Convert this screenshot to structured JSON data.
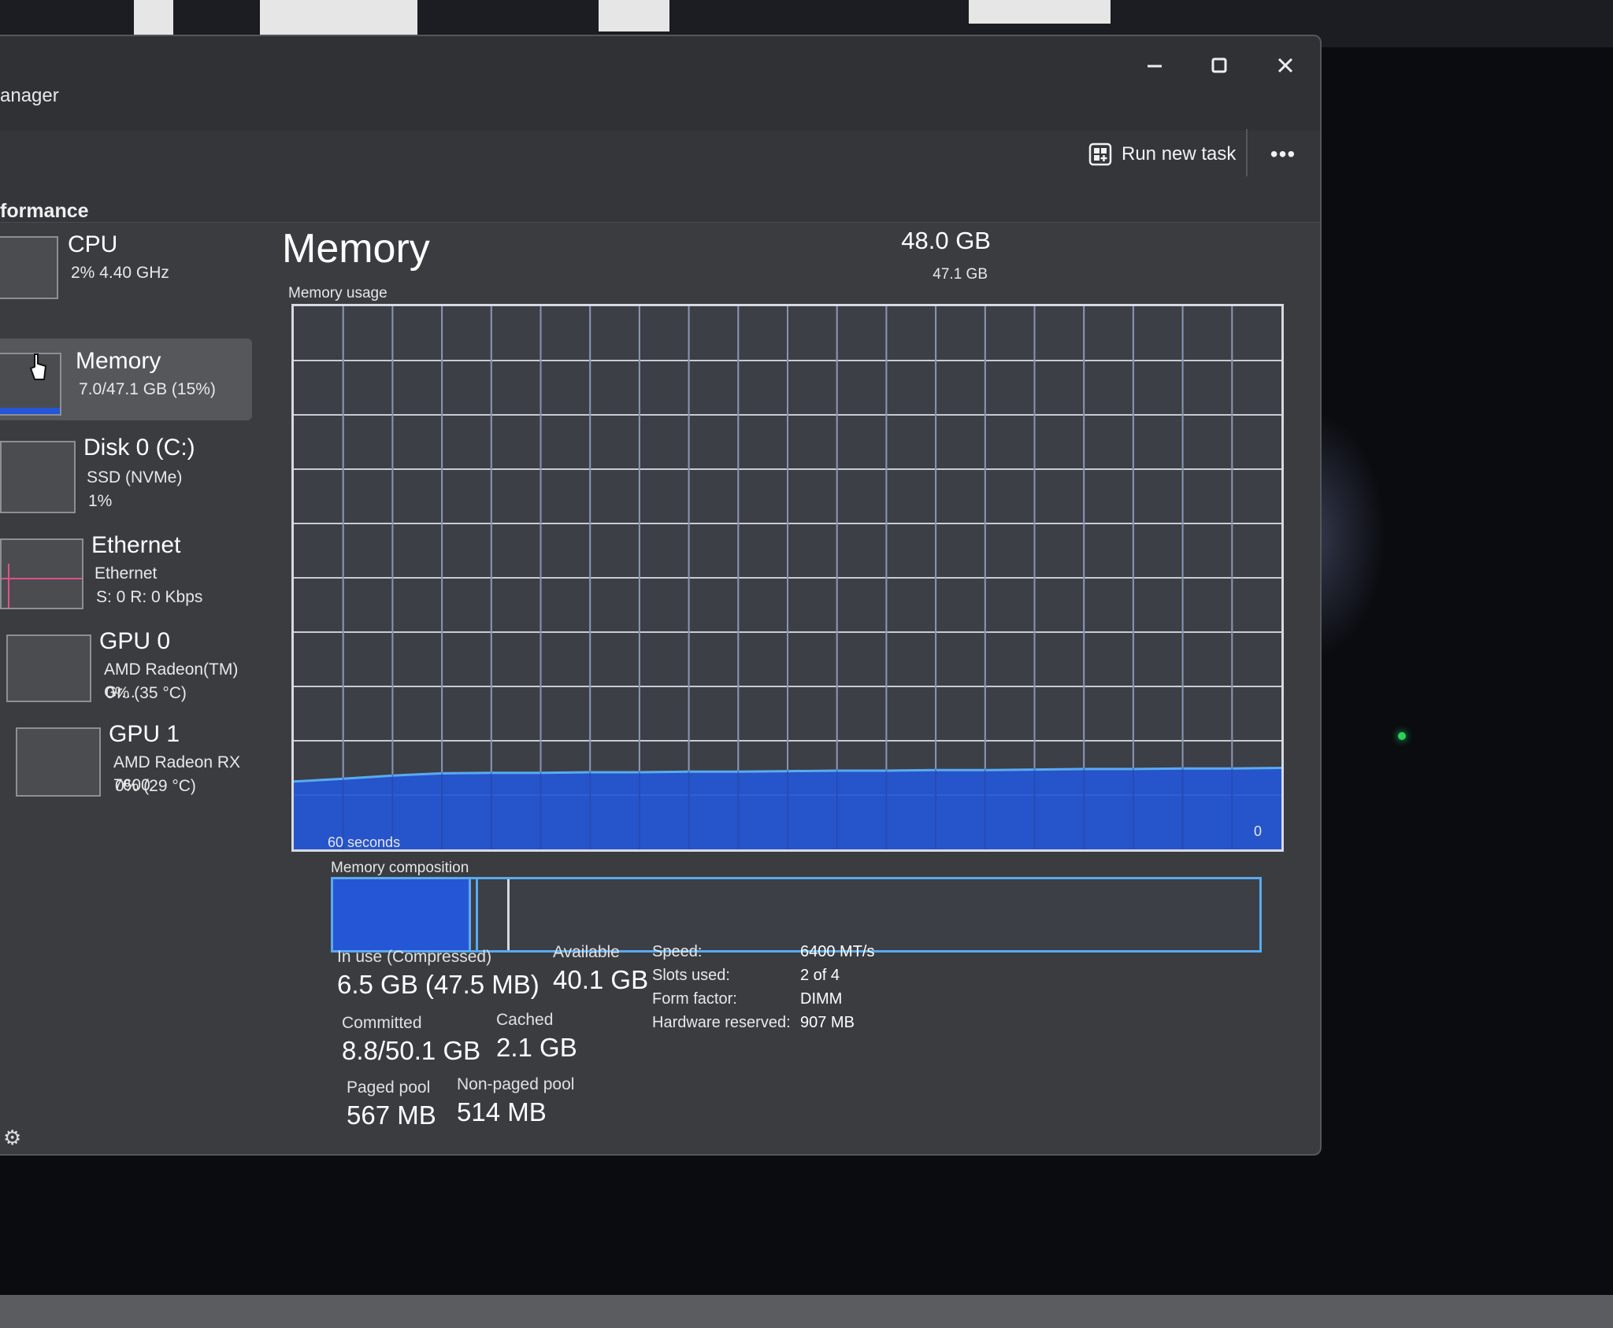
{
  "window": {
    "title": "anager",
    "controls": {
      "minimize": "minimize",
      "maximize": "maximize",
      "close": "close"
    }
  },
  "toolbar": {
    "page_heading": "formance",
    "run_new_task_label": "Run new task",
    "more_label": "•••"
  },
  "sidebar": {
    "items": [
      {
        "name": "CPU",
        "lines": [
          "2% 4.40 GHz"
        ]
      },
      {
        "name": "Memory",
        "lines": [
          "7.0/47.1 GB (15%)"
        ],
        "selected": true
      },
      {
        "name": "Disk 0 (C:)",
        "lines": [
          "SSD (NVMe)",
          "1%"
        ]
      },
      {
        "name": "Ethernet",
        "lines": [
          "Ethernet",
          "S: 0 R: 0 Kbps"
        ]
      },
      {
        "name": "GPU 0",
        "lines": [
          "AMD Radeon(TM) Gr...",
          "0% (35 °C)"
        ]
      },
      {
        "name": "GPU 1",
        "lines": [
          "AMD Radeon RX 7600",
          "0% (29 °C)"
        ]
      }
    ]
  },
  "main": {
    "title": "Memory",
    "total": "48.0 GB",
    "graph_max": "47.1 GB",
    "usage_caption": "Memory usage",
    "graph_time_label": "60 seconds",
    "graph_zero_label": "0",
    "composition_caption": "Memory composition",
    "usage_percent_history": [
      12.5,
      13.0,
      13.6,
      14.0,
      14.1,
      14.1,
      14.2,
      14.2,
      14.3,
      14.3,
      14.4,
      14.5,
      14.5,
      14.6,
      14.6,
      14.7,
      14.8,
      14.8,
      14.9,
      14.9,
      15.0
    ],
    "composition": {
      "in_use_fraction": 0.146,
      "modified_fraction": 0.01,
      "standby_fraction": 0.034
    },
    "stats": {
      "in_use": {
        "label": "In use (Compressed)",
        "value": "6.5 GB (47.5 MB)"
      },
      "available": {
        "label": "Available",
        "value": "40.1 GB"
      },
      "committed": {
        "label": "Committed",
        "value": "8.8/50.1 GB"
      },
      "cached": {
        "label": "Cached",
        "value": "2.1 GB"
      },
      "paged_pool": {
        "label": "Paged pool",
        "value": "567 MB"
      },
      "non_paged_pool": {
        "label": "Non-paged pool",
        "value": "514 MB"
      }
    },
    "details": [
      {
        "key": "Speed:",
        "value": "6400 MT/s"
      },
      {
        "key": "Slots used:",
        "value": "2 of 4"
      },
      {
        "key": "Form factor:",
        "value": "DIMM"
      },
      {
        "key": "Hardware reserved:",
        "value": "907 MB"
      }
    ]
  },
  "colors": {
    "accent": "#2556d6",
    "accent_border": "#5aaaf0",
    "grid": "#c8ccd4"
  },
  "icons": {
    "run_task": "run-task-icon",
    "settings": "gear-icon"
  }
}
